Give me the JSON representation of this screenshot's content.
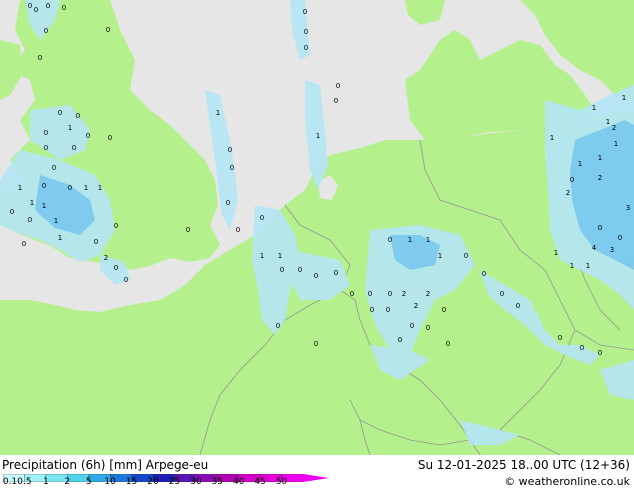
{
  "title": "Precipitation (6h) [mm] Arpege-eu",
  "valid_time": "Su 12-01-2025 18..00 UTC (12+36)",
  "copyright": "© weatheronline.co.uk",
  "legend": {
    "ticks": [
      "0.1",
      "0.5",
      "1",
      "2",
      "5",
      "10",
      "15",
      "20",
      "25",
      "30",
      "35",
      "40",
      "45",
      "50"
    ],
    "colors": [
      "#c8fafa",
      "#a0f0f5",
      "#78e6f0",
      "#50d2eb",
      "#2daae6",
      "#1e78dc",
      "#1446c8",
      "#1e1eb4",
      "#5a14b4",
      "#8c0ab4",
      "#b400b4",
      "#d200c8",
      "#e600dc",
      "#f000f0"
    ]
  },
  "map": {
    "land_color": "#b4f08c",
    "sea_color": "#e6e6e6",
    "border_color": "#969696",
    "rain_color": "#b4e6f5",
    "rain_color_heavy": "#78c8f0",
    "rain_labels": [
      "0",
      "0",
      "0",
      "0",
      "0",
      "0",
      "0",
      "0",
      "0",
      "0",
      "0",
      "0",
      "0",
      "0",
      "0",
      "0",
      "0",
      "0",
      "0",
      "0",
      "1",
      "1",
      "1",
      "1",
      "1",
      "1",
      "1",
      "1",
      "1",
      "1",
      "1",
      "1",
      "1",
      "1",
      "1",
      "2",
      "2",
      "2",
      "2",
      "2",
      "3",
      "3",
      "4",
      "0",
      "0",
      "0",
      "0",
      "0",
      "0",
      "0",
      "0",
      "0",
      "0",
      "0",
      "0",
      "0",
      "0",
      "0",
      "0",
      "0",
      "0",
      "0",
      "0",
      "0",
      "0",
      "0",
      "0",
      "0",
      "0",
      "0",
      "0",
      "1",
      "1",
      "1",
      "1",
      "1",
      "1",
      "1",
      "1",
      "1",
      "1",
      "2",
      "2",
      "0",
      "0",
      "0",
      "0",
      "0",
      "0",
      "0",
      "0",
      "0",
      "0",
      "0",
      "0",
      "0",
      "0",
      "0"
    ]
  }
}
